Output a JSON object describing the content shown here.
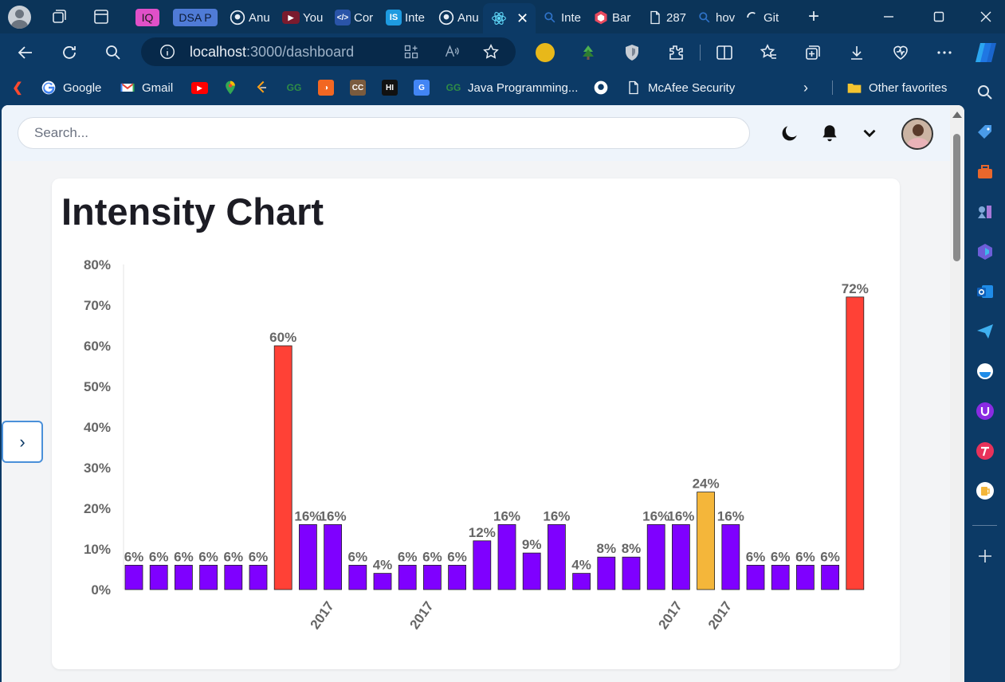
{
  "browser": {
    "tabs": [
      {
        "label": "IQ",
        "favicon": "iq-badge",
        "color": "#e050c8"
      },
      {
        "label": "DSA P",
        "favicon": "dsa-badge",
        "color": "#4f7bd6"
      },
      {
        "label": "Anu",
        "favicon": "github-icon"
      },
      {
        "label": "You",
        "favicon": "youtube-icon"
      },
      {
        "label": "Cor",
        "favicon": "code-icon"
      },
      {
        "label": "Inte",
        "favicon": "is-icon"
      },
      {
        "label": "Anu",
        "favicon": "github-icon"
      },
      {
        "label": "",
        "favicon": "react-icon",
        "active": true
      },
      {
        "label": "Inte",
        "favicon": "search-icon"
      },
      {
        "label": "Bar",
        "favicon": "cube-icon"
      },
      {
        "label": "287",
        "favicon": "page-icon"
      },
      {
        "label": "hov",
        "favicon": "search-icon"
      },
      {
        "label": "Git",
        "favicon": "loading-icon"
      }
    ],
    "address": {
      "host": "localhost",
      "rest": ":3000/dashboard"
    },
    "favorites": [
      {
        "label": "",
        "icon": "arrow-bookmark-icon"
      },
      {
        "label": "Google",
        "icon": "google-icon"
      },
      {
        "label": "Gmail",
        "icon": "gmail-icon"
      },
      {
        "label": "",
        "icon": "youtube-icon"
      },
      {
        "label": "",
        "icon": "maps-icon"
      },
      {
        "label": "",
        "icon": "leetcode-icon"
      },
      {
        "label": "",
        "icon": "gfg-icon"
      },
      {
        "label": "",
        "icon": "coding-ninjas-icon"
      },
      {
        "label": "",
        "icon": "codechef-icon"
      },
      {
        "label": "",
        "icon": "hackerrank-icon"
      },
      {
        "label": "",
        "icon": "translate-icon"
      },
      {
        "label": "Java Programming...",
        "icon": "gfg-icon"
      },
      {
        "label": "",
        "icon": "github-icon"
      },
      {
        "label": "McAfee Security",
        "icon": "page-icon"
      },
      {
        "label": "Other favorites",
        "icon": "folder-icon"
      }
    ]
  },
  "app": {
    "search_placeholder": "Search..."
  },
  "chart_data": {
    "type": "bar",
    "title": "Intensity Chart",
    "xlabel": "",
    "ylabel": "",
    "ylim": [
      0,
      80
    ],
    "y_ticks": [
      "0%",
      "10%",
      "20%",
      "30%",
      "40%",
      "50%",
      "60%",
      "70%",
      "80%"
    ],
    "categories": [
      "",
      "",
      "",
      "",
      "",
      "",
      "",
      "",
      "2017",
      "",
      "",
      "",
      "2017",
      "",
      "",
      "",
      "",
      "",
      "",
      "",
      "",
      "",
      "2017",
      "",
      "2017",
      "",
      "",
      "",
      "",
      ""
    ],
    "values": [
      6,
      6,
      6,
      6,
      6,
      6,
      60,
      16,
      16,
      6,
      4,
      6,
      6,
      6,
      12,
      16,
      9,
      16,
      4,
      8,
      8,
      16,
      16,
      24,
      16,
      6,
      6,
      6,
      6,
      72
    ],
    "value_labels": [
      "6%",
      "6%",
      "6%",
      "6%",
      "6%",
      "6%",
      "60%",
      "16%",
      "16%",
      "6%",
      "4%",
      "6%",
      "6%",
      "6%",
      "12%",
      "16%",
      "9%",
      "16%",
      "4%",
      "8%",
      "8%",
      "16%",
      "16%",
      "24%",
      "16%",
      "6%",
      "6%",
      "6%",
      "6%",
      "72%"
    ],
    "colors": {
      "low": "#7f00ff",
      "medium": "#f4b63a",
      "high": "#ff4136"
    },
    "color_rule": "high when value is 60% or more; medium when value is 24%; otherwise low",
    "grid": false,
    "legend": "none"
  }
}
